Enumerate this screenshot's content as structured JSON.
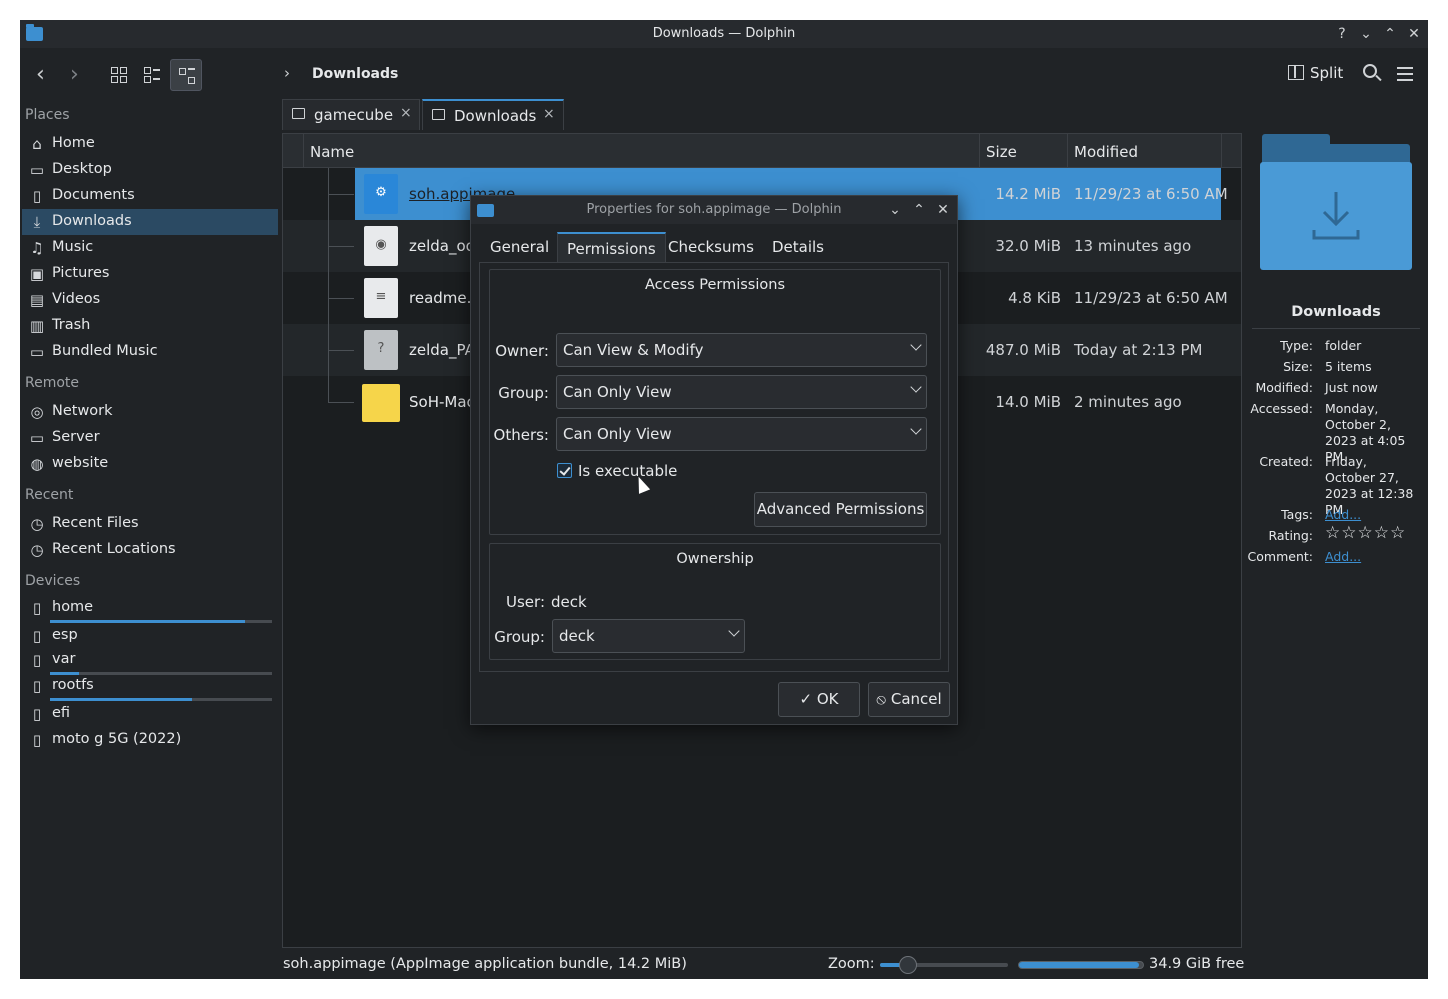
{
  "window": {
    "title": "Downloads — Dolphin"
  },
  "titlebar_buttons": [
    "?",
    "⌄",
    "⌃",
    "✕"
  ],
  "toolbar": {
    "breadcrumb": "Downloads",
    "split_label": "Split"
  },
  "sidebar": {
    "places_title": "Places",
    "places": [
      {
        "label": "Home",
        "icon": "home-icon",
        "glyph": "⌂"
      },
      {
        "label": "Desktop",
        "icon": "desktop-icon",
        "glyph": "▭"
      },
      {
        "label": "Documents",
        "icon": "documents-icon",
        "glyph": "▯"
      },
      {
        "label": "Downloads",
        "icon": "downloads-icon",
        "glyph": "⤓"
      },
      {
        "label": "Music",
        "icon": "music-icon",
        "glyph": "♫"
      },
      {
        "label": "Pictures",
        "icon": "pictures-icon",
        "glyph": "▣"
      },
      {
        "label": "Videos",
        "icon": "videos-icon",
        "glyph": "▤"
      },
      {
        "label": "Trash",
        "icon": "trash-icon",
        "glyph": "▥"
      },
      {
        "label": "Bundled Music",
        "icon": "folder-icon",
        "glyph": "▭"
      }
    ],
    "remote_title": "Remote",
    "remote": [
      {
        "label": "Network",
        "icon": "network-icon",
        "glyph": "◎"
      },
      {
        "label": "Server",
        "icon": "server-folder-icon",
        "glyph": "▭"
      },
      {
        "label": "website",
        "icon": "globe-icon",
        "glyph": "◍"
      }
    ],
    "recent_title": "Recent",
    "recent": [
      {
        "label": "Recent Files",
        "icon": "recent-files-icon",
        "glyph": "◷"
      },
      {
        "label": "Recent Locations",
        "icon": "recent-locations-icon",
        "glyph": "◷"
      }
    ],
    "devices_title": "Devices",
    "devices": [
      {
        "label": "home",
        "icon": "drive-icon",
        "glyph": "▯",
        "usage": 0.88
      },
      {
        "label": "esp",
        "icon": "drive-locked-icon",
        "glyph": "▯"
      },
      {
        "label": "var",
        "icon": "drive-icon",
        "glyph": "▯",
        "usage": 0.13
      },
      {
        "label": "rootfs",
        "icon": "drive-readonly-icon",
        "glyph": "▯",
        "usage": 0.64
      },
      {
        "label": "efi",
        "icon": "drive-locked-icon",
        "glyph": "▯"
      },
      {
        "label": "moto g 5G (2022)",
        "icon": "phone-icon",
        "glyph": "▯"
      }
    ]
  },
  "tabs": [
    {
      "label": "gamecube",
      "close": "×"
    },
    {
      "label": "Downloads",
      "close": "×"
    }
  ],
  "columns": {
    "name": "Name",
    "size": "Size",
    "modified": "Modified"
  },
  "files": [
    {
      "name": "soh.appimage",
      "size": "14.2 MiB",
      "modified": "11/29/23 at 6:50 AM"
    },
    {
      "name": "zelda_oo",
      "size": "32.0 MiB",
      "modified": "13 minutes ago"
    },
    {
      "name": "readme.t",
      "size": "4.8 KiB",
      "modified": "11/29/23 at 6:50 AM"
    },
    {
      "name": "zelda_PA",
      "size": "487.0 MiB",
      "modified": "Today at 2:13 PM"
    },
    {
      "name": "SoH-Mac",
      "size": "14.0 MiB",
      "modified": "2 minutes ago"
    }
  ],
  "info": {
    "title": "Downloads",
    "type_key": "Type:",
    "type": "folder",
    "size_key": "Size:",
    "size": "5 items",
    "modified_key": "Modified:",
    "modified": "Just now",
    "accessed_key": "Accessed:",
    "accessed": "Monday, October 2, 2023 at 4:05 PM",
    "created_key": "Created:",
    "created": "Friday, October 27, 2023 at 12:38 PM",
    "tags_key": "Tags:",
    "tags": "Add...",
    "rating_key": "Rating:",
    "rating": "☆☆☆☆☆",
    "rating_value": 0,
    "comment_key": "Comment:",
    "comment": "Add..."
  },
  "status": {
    "text": "soh.appimage (AppImage application bundle, 14.2 MiB)",
    "zoom_label": "Zoom:",
    "zoom_level": 0.22,
    "free_fraction": 0.97,
    "free_text": "34.9 GiB free"
  },
  "dialog": {
    "title": "Properties for soh.appimage — Dolphin",
    "title_buttons": [
      "⌄",
      "⌃",
      "✕"
    ],
    "tabs": [
      "General",
      "Permissions",
      "Checksums",
      "Details"
    ],
    "access_title": "Access Permissions",
    "owner_label": "Owner:",
    "owner_value": "Can View & Modify",
    "group_label": "Group:",
    "group_value": "Can Only View",
    "others_label": "Others:",
    "others_value": "Can Only View",
    "executable_label": "Is executable",
    "advanced_label": "Advanced Permissions",
    "ownership_title": "Ownership",
    "user_label": "User:",
    "user_value": "deck",
    "own_group_label": "Group:",
    "own_group_value": "deck",
    "ok_label": "OK",
    "cancel_label": "Cancel"
  },
  "colors": {
    "accent": "#3d8fd0",
    "background": "#202326",
    "selection": "#3d8fd0"
  }
}
